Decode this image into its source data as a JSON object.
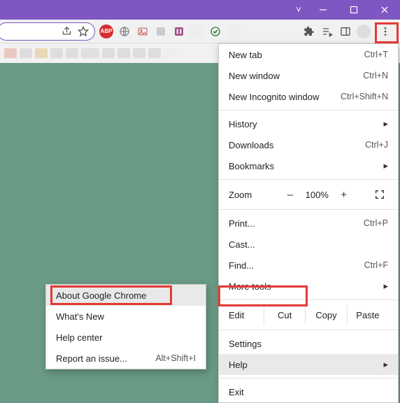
{
  "titlebar": {
    "tabdrop_glyph": "˅"
  },
  "toolbar": {
    "extensions": [
      "ABP",
      "globe",
      "image",
      "user",
      "grid",
      "blank",
      "check",
      "blank2",
      "puzzle",
      "playlist",
      "panel",
      "avatar"
    ]
  },
  "main_menu": {
    "new_tab": "New tab",
    "new_tab_sc": "Ctrl+T",
    "new_window": "New window",
    "new_window_sc": "Ctrl+N",
    "new_incognito": "New Incognito window",
    "new_incognito_sc": "Ctrl+Shift+N",
    "history": "History",
    "downloads": "Downloads",
    "downloads_sc": "Ctrl+J",
    "bookmarks": "Bookmarks",
    "zoom": "Zoom",
    "zoom_minus": "–",
    "zoom_val": "100%",
    "zoom_plus": "+",
    "print": "Print...",
    "print_sc": "Ctrl+P",
    "cast": "Cast...",
    "find": "Find...",
    "find_sc": "Ctrl+F",
    "more_tools": "More tools",
    "edit": "Edit",
    "cut": "Cut",
    "copy": "Copy",
    "paste": "Paste",
    "settings": "Settings",
    "help": "Help",
    "exit": "Exit"
  },
  "help_menu": {
    "about": "About Google Chrome",
    "whats_new": "What's New",
    "help_center": "Help center",
    "report": "Report an issue...",
    "report_sc": "Alt+Shift+I"
  }
}
